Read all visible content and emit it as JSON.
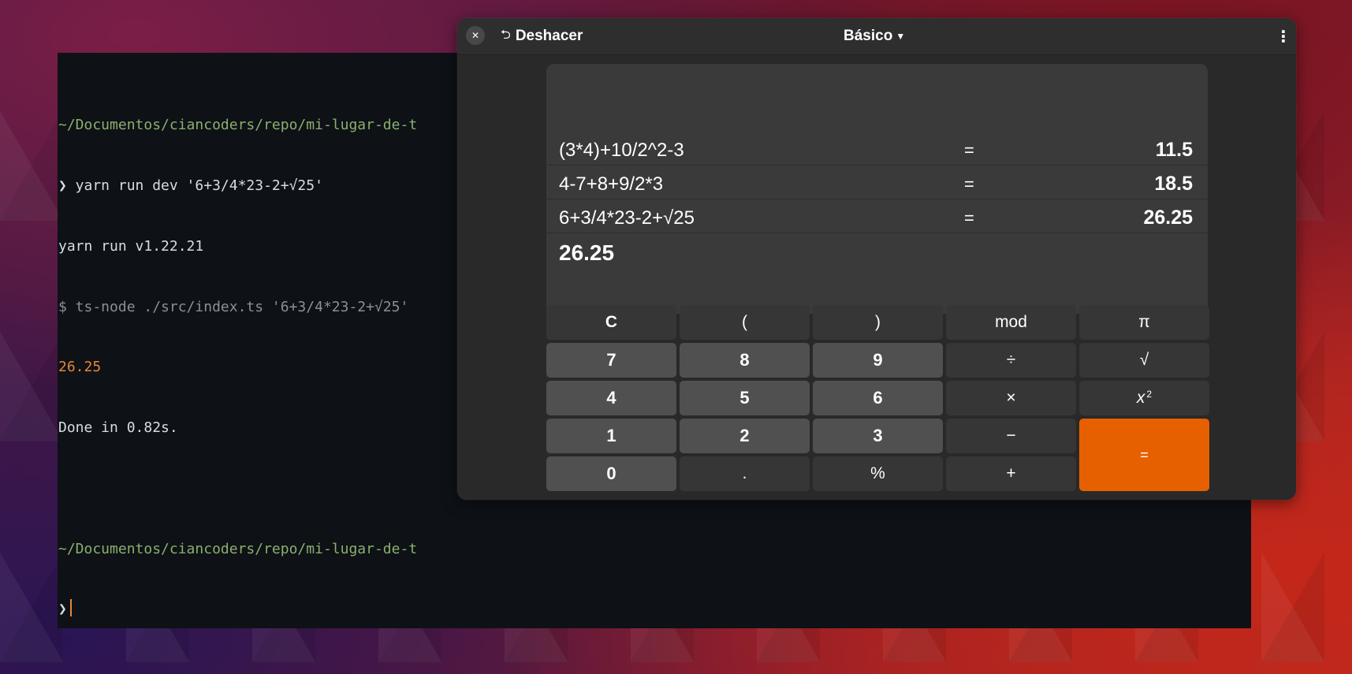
{
  "terminal": {
    "lines": [
      {
        "text": "~/Documentos/ciancoders/repo/mi-lugar-de-t",
        "style": "path"
      },
      {
        "text": "❯ yarn run dev '6+3/4*23-2+√25'",
        "style": "normal"
      },
      {
        "text": "yarn run v1.22.21",
        "style": "normal"
      },
      {
        "text": "$ ts-node ./src/index.ts '6+3/4*23-2+√25'",
        "style": "dim"
      },
      {
        "text": "26.25",
        "style": "num"
      },
      {
        "text": "Done in 0.82s.",
        "style": "normal"
      },
      {
        "text": "",
        "style": "normal"
      },
      {
        "text": "~/Documentos/ciancoders/repo/mi-lugar-de-t",
        "style": "path"
      }
    ],
    "prompt": "❯"
  },
  "calculator": {
    "undo_label": "Deshacer",
    "mode_label": "Básico",
    "history": [
      {
        "expr": "(3*4)+10/2^2-3",
        "eq": "=",
        "result": "11.5"
      },
      {
        "expr": "4-7+8+9/2*3",
        "eq": "=",
        "result": "18.5"
      },
      {
        "expr": "6+3/4*23-2+√25",
        "eq": "=",
        "result": "26.25"
      }
    ],
    "current_value": "26.25",
    "keys": {
      "clear": "C",
      "paren_open": "(",
      "paren_close": ")",
      "mod": "mod",
      "pi": "π",
      "k7": "7",
      "k8": "8",
      "k9": "9",
      "divide": "÷",
      "sqrt": "√",
      "k4": "4",
      "k5": "5",
      "k6": "6",
      "multiply": "×",
      "square_base": "x",
      "square_exp": "2",
      "k1": "1",
      "k2": "2",
      "k3": "3",
      "minus": "−",
      "equals": "=",
      "k0": "0",
      "decimal": ".",
      "percent": "%",
      "plus": "+"
    },
    "accent_color": "#e66000"
  },
  "icons": {
    "close": "close-icon",
    "undo": "undo-icon",
    "dropdown": "chevron-down-icon",
    "menu": "kebab-menu-icon"
  }
}
